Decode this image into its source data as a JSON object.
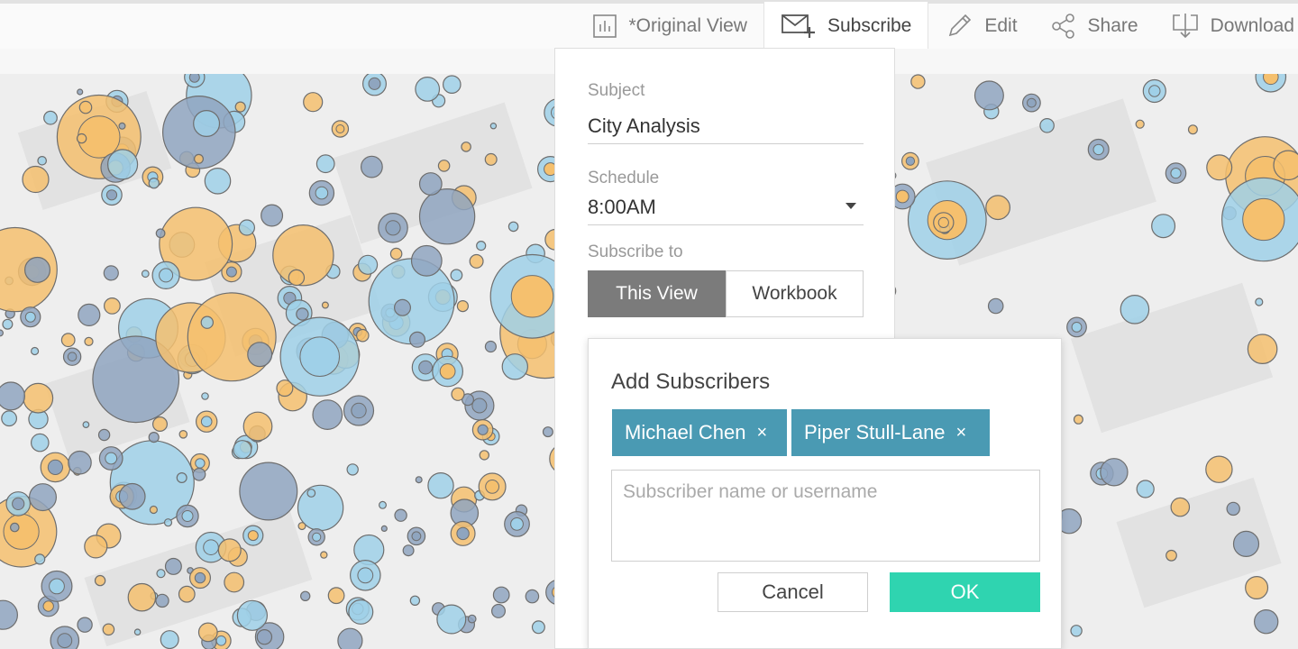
{
  "toolbar": {
    "items": [
      {
        "label": "*Original View",
        "icon": "bar-chart-icon"
      },
      {
        "label": "Subscribe",
        "icon": "mail-plus-icon"
      },
      {
        "label": "Edit",
        "icon": "pencil-icon"
      },
      {
        "label": "Share",
        "icon": "share-icon"
      },
      {
        "label": "Download",
        "icon": "download-icon"
      }
    ]
  },
  "subscribe_panel": {
    "subject_label": "Subject",
    "subject_value": "City Analysis",
    "schedule_label": "Schedule",
    "schedule_value": "8:00AM",
    "subscribe_to_label": "Subscribe to",
    "options": [
      "This View",
      "Workbook"
    ],
    "selected_option": "This View"
  },
  "add_subscribers": {
    "title": "Add Subscribers",
    "subscribers": [
      "Michael Chen",
      "Piper Stull-Lane"
    ],
    "remove_glyph": "×",
    "input_placeholder": "Subscriber name or username",
    "cancel_label": "Cancel",
    "ok_label": "OK"
  },
  "colors": {
    "accent_ok": "#2fd4b0",
    "chip": "#4a9ab3",
    "selected_segment": "#7b7b7b",
    "map_orange": "#f5c06e",
    "map_blue": "#8fa5bf",
    "map_light_blue": "#9fd0e8"
  }
}
